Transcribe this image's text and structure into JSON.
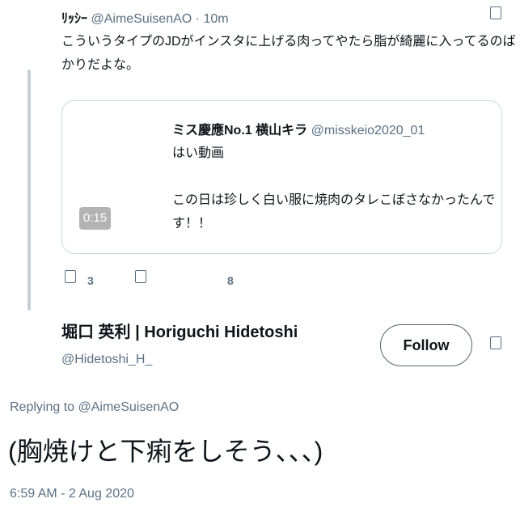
{
  "reply_tweet": {
    "display_name": "ﾘｯｼｰ",
    "handle": "@AimeSuisenAO",
    "separator": "·",
    "time": "10m",
    "text_line1": "こういうタイプのJDがインスタに上げる肉ってやたら脂が綺麗に入ってるのば",
    "text_line2": "かりだよな。",
    "reply_count": "3",
    "like_count": "8",
    "icons": [
      "more-icon",
      "reply-icon",
      "retweet-icon"
    ]
  },
  "quoted_tweet": {
    "display_name": "ミス慶應No.1 横山キラ",
    "handle": "@misskeio2020_01",
    "text_line1": "はい動画",
    "text_line2": "この日は珍しく白い服に焼肉のタレこぼさなかったんで",
    "text_line3": "す！！",
    "video_duration": "0:15"
  },
  "main_tweet": {
    "display_name": "堀口 英利 | Horiguchi Hidetoshi",
    "handle": "@Hidetoshi_H_",
    "follow_label": "Follow",
    "replying_to_prefix": "Replying to ",
    "replying_to_handle": "@AimeSuisenAO",
    "text": "(胸焼けと下痢をしそう、、、)",
    "timestamp": "6:59 AM - 2 Aug 2020",
    "icons": [
      "more-icon"
    ]
  },
  "colors": {
    "text": "#0f1419",
    "muted": "#5b7083",
    "thread_line": "#c4cfd6",
    "card_border": "#cfd9de",
    "video_badge": "#b3b3b3"
  }
}
